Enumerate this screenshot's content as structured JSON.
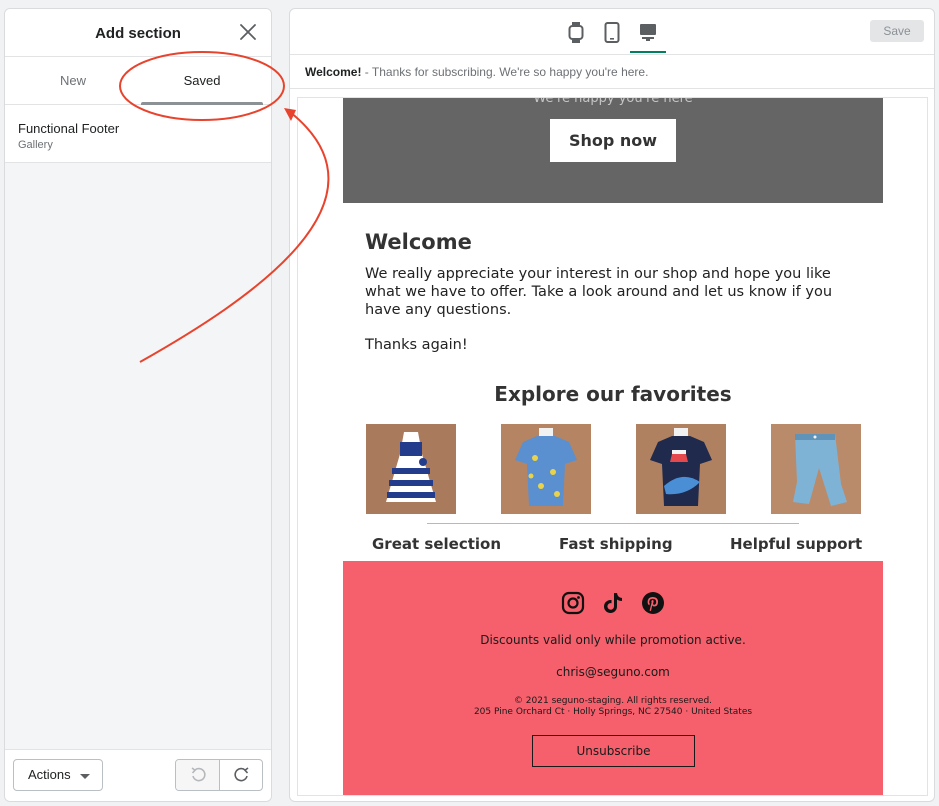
{
  "left_panel": {
    "title": "Add section",
    "tabs": [
      {
        "label": "New",
        "active": false
      },
      {
        "label": "Saved",
        "active": true
      }
    ],
    "items": [
      {
        "name": "Functional Footer",
        "type": "Gallery"
      }
    ],
    "footer": {
      "actions_label": "Actions"
    }
  },
  "toolbar": {
    "devices": [
      "watch-icon",
      "tablet-icon",
      "desktop-icon"
    ],
    "active_device": "desktop",
    "save_label": "Save"
  },
  "preheader": {
    "bold": "Welcome!",
    "text": " - Thanks for subscribing. We're so happy you're here."
  },
  "email": {
    "hero": {
      "cut_text": "We're happy you're here",
      "button": "Shop now"
    },
    "welcome": {
      "title": "Welcome",
      "body": "We really appreciate your interest in our shop and hope you like what we have to offer. Take a look around and let us know if you have any questions.",
      "thanks": "Thanks again!"
    },
    "favorites": {
      "title": "Explore our favorites",
      "products": [
        "striped dress",
        "blue printed tee",
        "navy whale tee",
        "denim jeans"
      ]
    },
    "features": [
      "Great selection",
      "Fast shipping",
      "Helpful support"
    ],
    "footer": {
      "social": [
        "instagram-icon",
        "tiktok-icon",
        "pinterest-icon"
      ],
      "disclaimer": "Discounts valid only while promotion active.",
      "email": "chris@seguno.com",
      "copyright": "© 2021 seguno-staging. All rights reserved.",
      "address": "205 Pine Orchard Ct · Holly Springs, NC 27540 · United States",
      "unsubscribe": "Unsubscribe"
    }
  },
  "colors": {
    "hero_bg": "#656565",
    "footer_bg": "#f5606c",
    "annotation": "#e8432d",
    "active_device": "#008060"
  }
}
